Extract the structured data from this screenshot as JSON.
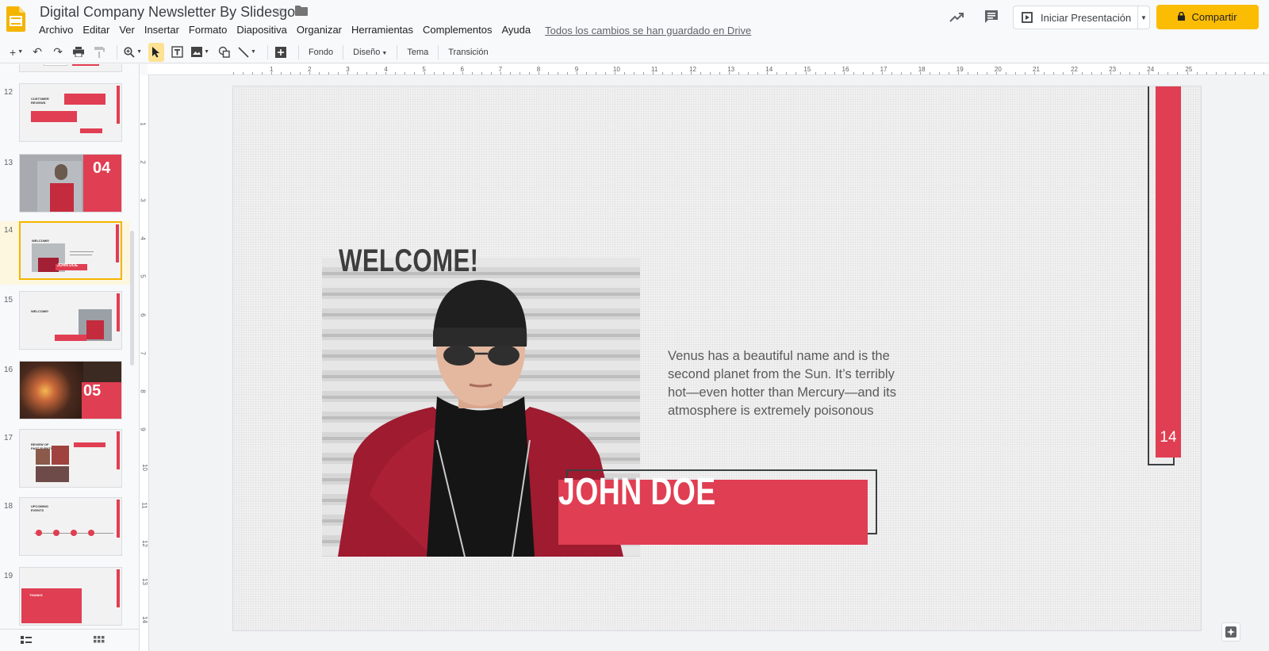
{
  "header": {
    "title": "Digital Company Newsletter By Slidesgo",
    "menus": [
      "Archivo",
      "Editar",
      "Ver",
      "Insertar",
      "Formato",
      "Diapositiva",
      "Organizar",
      "Herramientas",
      "Complementos",
      "Ayuda"
    ],
    "save_status": "Todos los cambios se han guardado en Drive",
    "present_label": "Iniciar Presentación",
    "share_label": "Compartir"
  },
  "toolbar": {
    "background_label": "Fondo",
    "design_label": "Diseño",
    "theme_label": "Tema",
    "transition_label": "Transición"
  },
  "filmstrip": {
    "slides": [
      {
        "number": "12",
        "heading": "CUSTOMER REVIEWS"
      },
      {
        "number": "13",
        "heading": "04"
      },
      {
        "number": "14",
        "heading": "WELCOME!",
        "name": "JOHN DOE",
        "selected": true
      },
      {
        "number": "15",
        "heading": "WELCOME!"
      },
      {
        "number": "16",
        "heading": "05"
      },
      {
        "number": "17",
        "heading": "REVIEW OF PAST EVENTS"
      },
      {
        "number": "18",
        "heading": "UPCOMING EVENTS"
      },
      {
        "number": "19",
        "heading": "THANKS"
      }
    ]
  },
  "ruler": {
    "top_labels": [
      "1",
      "2",
      "3",
      "4",
      "5",
      "6",
      "7",
      "8",
      "9",
      "10",
      "11",
      "12",
      "13",
      "14",
      "15",
      "16",
      "17",
      "18",
      "19",
      "20",
      "21",
      "22",
      "23",
      "24",
      "25"
    ],
    "left_labels": [
      "1",
      "2",
      "3",
      "4",
      "5",
      "6",
      "7",
      "8",
      "9",
      "10",
      "11",
      "12",
      "13",
      "14"
    ]
  },
  "slide": {
    "title": "WELCOME!",
    "body": "Venus has a beautiful name and is the second planet from the Sun. It’s terribly hot—even hotter than Mercury—and its atmosphere is extremely poisonous",
    "name": "JOHN DOE",
    "number": "14"
  },
  "colors": {
    "accent": "#e03e52",
    "share": "#fbbc04",
    "dark": "#3c4043"
  }
}
